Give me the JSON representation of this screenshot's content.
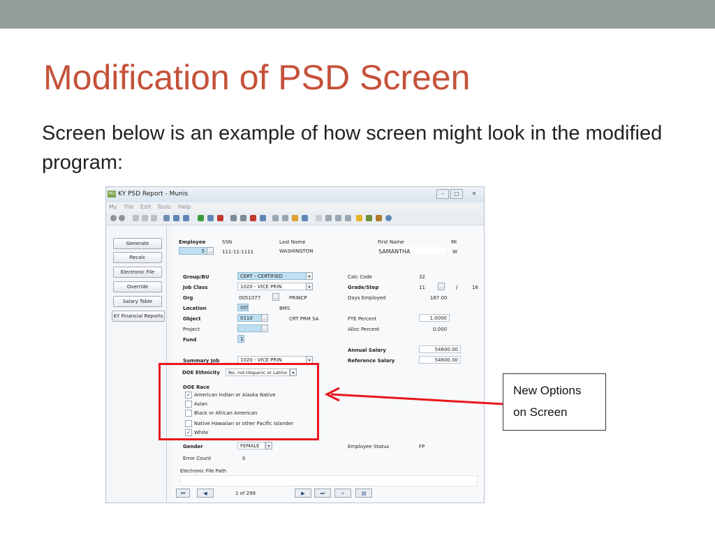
{
  "slide": {
    "title": "Modification of PSD Screen",
    "body": "Screen below is an example of how screen might look in the modified program:"
  },
  "window": {
    "title": "KY PSD Report - Munis",
    "app_icon_text": "MU",
    "menu": [
      "My",
      "File",
      "Edit",
      "Tools",
      "Help"
    ]
  },
  "left_buttons": [
    "Generate",
    "Recalc",
    "Electronic File",
    "Override",
    "Salary Table",
    "KY Financial Reports"
  ],
  "employee": {
    "employee_label": "Employee",
    "employee_value": "5",
    "ssn_label": "SSN",
    "ssn_value": "111-11-1111",
    "last_name_label": "Last Name",
    "last_name_value": "WASHINGTON",
    "first_name_label": "First Name",
    "first_name_value": "SAMANTHA",
    "mi_label": "MI",
    "mi_value": "W"
  },
  "fields": {
    "group_bu_label": "Group/BU",
    "group_bu_value": "CERT - CERTIFIED",
    "job_class_label": "Job Class",
    "job_class_value": "1020 - VICE PRIN",
    "org_label": "Org",
    "org_value": "0051077",
    "org_desc": "PRINCP",
    "location_label": "Location",
    "location_value": "005",
    "location_desc": "BMS",
    "object_label": "Object",
    "object_value": "0110",
    "object_desc": "CRT PRM SA",
    "project_label": "Project",
    "project_value": "",
    "fund_label": "Fund",
    "fund_value": "1",
    "summary_job_label": "Summary Job",
    "summary_job_value": "1020 - VICE PRIN",
    "calc_code_label": "Calc Code",
    "calc_code_value": "32",
    "grade_step_label": "Grade/Step",
    "grade_value": "11",
    "grade_sep": "/",
    "step_value": "16",
    "days_employed_label": "Days Employed",
    "days_employed_value": "187.00",
    "fte_percent_label": "FTE Percent",
    "fte_percent_value": "1.0000",
    "alloc_percent_label": "Alloc Percent",
    "alloc_percent_value": "0.000",
    "annual_salary_label": "Annual Salary",
    "annual_salary_value": "54600.00",
    "reference_salary_label": "Reference Salary",
    "reference_salary_value": "54600.00"
  },
  "doe": {
    "ethnicity_label": "DOE Ethnicity",
    "ethnicity_value": "No, not Hispanic or Latino",
    "race_label": "DOE Race",
    "races": [
      {
        "label": "American Indian or Alaska Native",
        "checked": true
      },
      {
        "label": "Asian",
        "checked": false
      },
      {
        "label": "Black or African American",
        "checked": false
      },
      {
        "label": "Native Hawaiian or other Pacific Islander",
        "checked": false
      },
      {
        "label": "White",
        "checked": true
      }
    ]
  },
  "bottom": {
    "gender_label": "Gender",
    "gender_value": "FEMALE",
    "error_count_label": "Error Count",
    "error_count_value": "0",
    "employee_status_label": "Employee Status",
    "employee_status_value": "FP",
    "efile_path_label": "Electronic File Path",
    "page_text": "1 of 299"
  },
  "callout": {
    "line1": "New Options",
    "line2": "on Screen"
  },
  "colors": {
    "title": "#c5513a",
    "top_band": "#919e97",
    "highlight": "#e8161c",
    "field_blue": "#bfe0f2"
  }
}
